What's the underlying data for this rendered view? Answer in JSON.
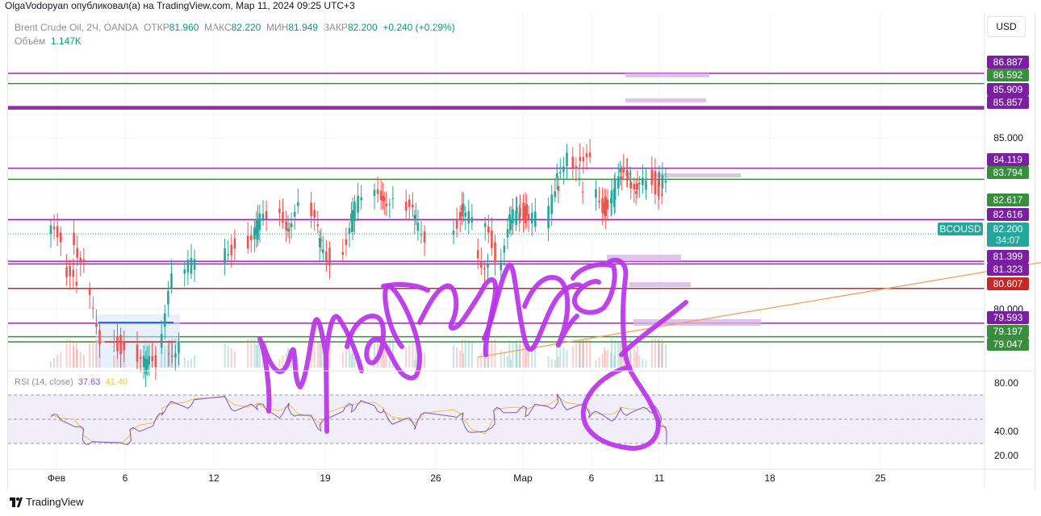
{
  "attribution": "OlgaVodopyan опубликовал(а) на TradingView.com, Мар 11, 2024 09:25 UTC+3",
  "legend": {
    "instrument": "Brent Crude Oil, 2Ч, OANDA",
    "open_label": "ОТКР",
    "open": "81.960",
    "high_label": "МАКС",
    "high": "82.220",
    "low_label": "МИН",
    "low": "81.949",
    "close_label": "ЗАКР",
    "close": "82.200",
    "change": "+0.240 (+0.29%)",
    "volume_label": "Объём",
    "volume": "1.147K"
  },
  "currency_button": "USD",
  "rsi": {
    "label": "RSI (14, close)",
    "value": "37.63",
    "ma": "41.40"
  },
  "footer": {
    "logo_text": "TradingView"
  },
  "colors": {
    "purple": "#7b1fa2",
    "green": "#388e3c",
    "red": "#c62828",
    "teal": "#26a69a",
    "bear": "#ef5350",
    "marker": "#b833e8",
    "orange": "#f0a35e"
  },
  "chart_data": {
    "type": "candlestick",
    "price_axis": {
      "ticks": [
        "85.000",
        "80.000"
      ],
      "tags": [
        {
          "value": "86.887",
          "color": "purple"
        },
        {
          "value": "86.592",
          "color": "green"
        },
        {
          "value": "85.909",
          "color": "purple"
        },
        {
          "value": "85.857",
          "color": "purple"
        },
        {
          "value": "84.119",
          "color": "purple"
        },
        {
          "value": "83.794",
          "color": "green"
        },
        {
          "value": "82.617",
          "color": "green"
        },
        {
          "value": "82.616",
          "color": "purple"
        },
        {
          "value": "81.399",
          "color": "purple"
        },
        {
          "value": "81.323",
          "color": "purple"
        },
        {
          "value": "80.607",
          "color": "red"
        },
        {
          "value": "79.593",
          "color": "purple"
        },
        {
          "value": "79.197",
          "color": "green"
        },
        {
          "value": "79.047",
          "color": "green"
        }
      ],
      "current": {
        "symbol": "BCOUSD",
        "price": "82.200",
        "countdown": "34:07"
      }
    },
    "rsi_axis": {
      "ticks": [
        "80.00",
        "40.00",
        "20.00"
      ],
      "band": [
        30,
        70
      ]
    },
    "time_axis": {
      "labels": [
        "Фев",
        "6",
        "12",
        "19",
        "26",
        "Мар",
        "6",
        "11",
        "18",
        "25"
      ]
    },
    "trendline": {
      "from": [
        "Фев 28",
        78.6
      ],
      "to": [
        "Апр 1",
        81.4
      ]
    },
    "price_series": [
      {
        "t": "Фев 1",
        "p": 82.2
      },
      {
        "t": "Фев 2",
        "p": 81.3
      },
      {
        "t": "Фев 2",
        "p": 80.5
      },
      {
        "t": "Фев 3",
        "p": 79.2
      },
      {
        "t": "Фев 5",
        "p": 78.8
      },
      {
        "t": "Фев 6",
        "p": 78.3
      },
      {
        "t": "Фев 7",
        "p": 78.5
      },
      {
        "t": "Фев 8",
        "p": 79.1
      },
      {
        "t": "Фев 8",
        "p": 80.8
      },
      {
        "t": "Фев 9",
        "p": 81.6
      },
      {
        "t": "Фев 12",
        "p": 81.9
      },
      {
        "t": "Фев 13",
        "p": 82.4
      },
      {
        "t": "Фев 14",
        "p": 82.7
      },
      {
        "t": "Фев 15",
        "p": 82.5
      },
      {
        "t": "Фев 16",
        "p": 82.9
      },
      {
        "t": "Фев 17",
        "p": 82.0
      },
      {
        "t": "Фев 18",
        "p": 81.5
      },
      {
        "t": "Фев 19",
        "p": 82.7
      },
      {
        "t": "Фев 20",
        "p": 83.2
      },
      {
        "t": "Фев 21",
        "p": 83.4
      },
      {
        "t": "Фев 22",
        "p": 83.1
      },
      {
        "t": "Фев 23",
        "p": 82.6
      },
      {
        "t": "Фев 24",
        "p": 82.2
      },
      {
        "t": "Фев 26",
        "p": 83.0
      },
      {
        "t": "Фев 27",
        "p": 82.5
      },
      {
        "t": "Фев 28",
        "p": 81.6
      },
      {
        "t": "Фев 28",
        "p": 81.3
      },
      {
        "t": "Фев 29",
        "p": 82.4
      },
      {
        "t": "Мар 1",
        "p": 83.0
      },
      {
        "t": "Мар 1",
        "p": 82.8
      },
      {
        "t": "Мар 2",
        "p": 82.6
      },
      {
        "t": "Мар 3",
        "p": 83.6
      },
      {
        "t": "Мар 4",
        "p": 84.7
      },
      {
        "t": "Мар 5",
        "p": 84.2
      },
      {
        "t": "Мар 5",
        "p": 83.5
      },
      {
        "t": "Мар 6",
        "p": 82.9
      },
      {
        "t": "Мар 7",
        "p": 83.3
      },
      {
        "t": "Мар 7",
        "p": 83.8
      },
      {
        "t": "Мар 8",
        "p": 84.2
      },
      {
        "t": "Мар 8",
        "p": 83.3
      },
      {
        "t": "Мар 9",
        "p": 83.7
      },
      {
        "t": "Мар 10",
        "p": 84.0
      },
      {
        "t": "Мар 10",
        "p": 83.2
      },
      {
        "t": "Мар 11",
        "p": 82.4
      },
      {
        "t": "Мар 11",
        "p": 82.2
      }
    ],
    "rsi_series": [
      {
        "t": "Фев 1",
        "v": 52
      },
      {
        "t": "Фев 2",
        "v": 48
      },
      {
        "t": "Фев 3",
        "v": 35
      },
      {
        "t": "Фев 5",
        "v": 28
      },
      {
        "t": "Фев 6",
        "v": 38
      },
      {
        "t": "Фев 7",
        "v": 45
      },
      {
        "t": "Фев 8",
        "v": 57
      },
      {
        "t": "Фев 9",
        "v": 62
      },
      {
        "t": "Фев 12",
        "v": 66
      },
      {
        "t": "Фев 13",
        "v": 58
      },
      {
        "t": "Фев 14",
        "v": 62
      },
      {
        "t": "Фев 15",
        "v": 55
      },
      {
        "t": "Фев 16",
        "v": 61
      },
      {
        "t": "Фев 17",
        "v": 50
      },
      {
        "t": "Фев 18",
        "v": 42
      },
      {
        "t": "Фев 19",
        "v": 58
      },
      {
        "t": "Фев 20",
        "v": 60
      },
      {
        "t": "Фев 21",
        "v": 62
      },
      {
        "t": "Фев 22",
        "v": 55
      },
      {
        "t": "Фев 23",
        "v": 48
      },
      {
        "t": "Фев 24",
        "v": 44
      },
      {
        "t": "Фев 26",
        "v": 56
      },
      {
        "t": "Фев 27",
        "v": 50
      },
      {
        "t": "Фев 28",
        "v": 36
      },
      {
        "t": "Фев 29",
        "v": 55
      },
      {
        "t": "Мар 1",
        "v": 58
      },
      {
        "t": "Мар 2",
        "v": 56
      },
      {
        "t": "Мар 3",
        "v": 60
      },
      {
        "t": "Мар 4",
        "v": 67
      },
      {
        "t": "Мар 5",
        "v": 60
      },
      {
        "t": "Мар 6",
        "v": 54
      },
      {
        "t": "Мар 7",
        "v": 52
      },
      {
        "t": "Мар 8",
        "v": 58
      },
      {
        "t": "Мар 9",
        "v": 56
      },
      {
        "t": "Мар 10",
        "v": 60
      },
      {
        "t": "Мар 10",
        "v": 48
      },
      {
        "t": "Мар 11",
        "v": 32
      },
      {
        "t": "Мар 11",
        "v": 37.6
      }
    ]
  }
}
